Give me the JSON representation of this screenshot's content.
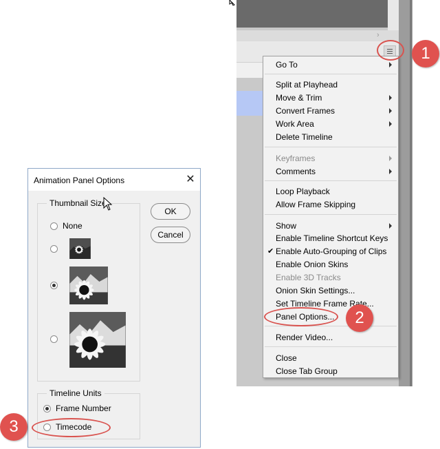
{
  "menu": {
    "items": [
      {
        "label": "Go To",
        "submenu": true
      },
      {
        "label": "Split at Playhead"
      },
      {
        "label": "Move & Trim",
        "submenu": true
      },
      {
        "label": "Convert Frames",
        "submenu": true
      },
      {
        "label": "Work Area",
        "submenu": true
      },
      {
        "label": "Delete Timeline"
      },
      {
        "label": "Keyframes",
        "submenu": true,
        "disabled": true
      },
      {
        "label": "Comments",
        "submenu": true
      },
      {
        "label": "Loop Playback"
      },
      {
        "label": "Allow Frame Skipping"
      },
      {
        "label": "Show",
        "submenu": true
      },
      {
        "label": "Enable Timeline Shortcut Keys"
      },
      {
        "label": "Enable Auto-Grouping of Clips",
        "checked": true
      },
      {
        "label": "Enable Onion Skins"
      },
      {
        "label": "Enable 3D Tracks",
        "disabled": true
      },
      {
        "label": "Onion Skin Settings..."
      },
      {
        "label": "Set Timeline Frame Rate..."
      },
      {
        "label": "Panel Options..."
      },
      {
        "label": "Render Video..."
      },
      {
        "label": "Close"
      },
      {
        "label": "Close Tab Group"
      }
    ]
  },
  "dialog": {
    "title": "Animation Panel Options",
    "thumbnail_group": "Thumbnail Size",
    "none_label": "None",
    "selected_thumbnail": "medium",
    "ok_label": "OK",
    "cancel_label": "Cancel",
    "units_group": "Timeline Units",
    "frame_number_label": "Frame Number",
    "timecode_label": "Timecode",
    "selected_unit": "Frame Number"
  },
  "callouts": {
    "one": "1",
    "two": "2",
    "three": "3",
    "color": "#e0524f"
  }
}
